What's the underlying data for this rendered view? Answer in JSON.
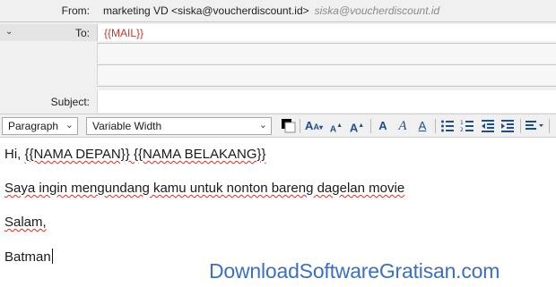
{
  "header": {
    "from_label": "From:",
    "from_value": "marketing VD <siska@voucherdiscount.id>",
    "from_alt": "siska@voucherdiscount.id",
    "to_label": "To:",
    "to_value": "{{MAIL}}",
    "subject_label": "Subject:",
    "subject_value": ""
  },
  "toolbar": {
    "paragraph_select": "Paragraph",
    "font_select": "Variable Width",
    "icons": [
      "text-color-icon",
      "smaller-font-icon",
      "larger-font-icon",
      "bold-icon",
      "italic-icon",
      "underline-icon",
      "bulleted-list-icon",
      "numbered-list-icon",
      "decrease-indent-icon",
      "increase-indent-icon",
      "align-icon"
    ]
  },
  "message": {
    "line1_hi": "Hi, ",
    "line1_name": "{{NAMA DEPAN}} {{NAMA BELAKANG}}",
    "line2": "Saya ingin mengundang kamu untuk nonton bareng dagelan movie",
    "line3": "Salam,",
    "line4": "Batman"
  },
  "watermark": "DownloadSoftwareGratisan.com"
}
